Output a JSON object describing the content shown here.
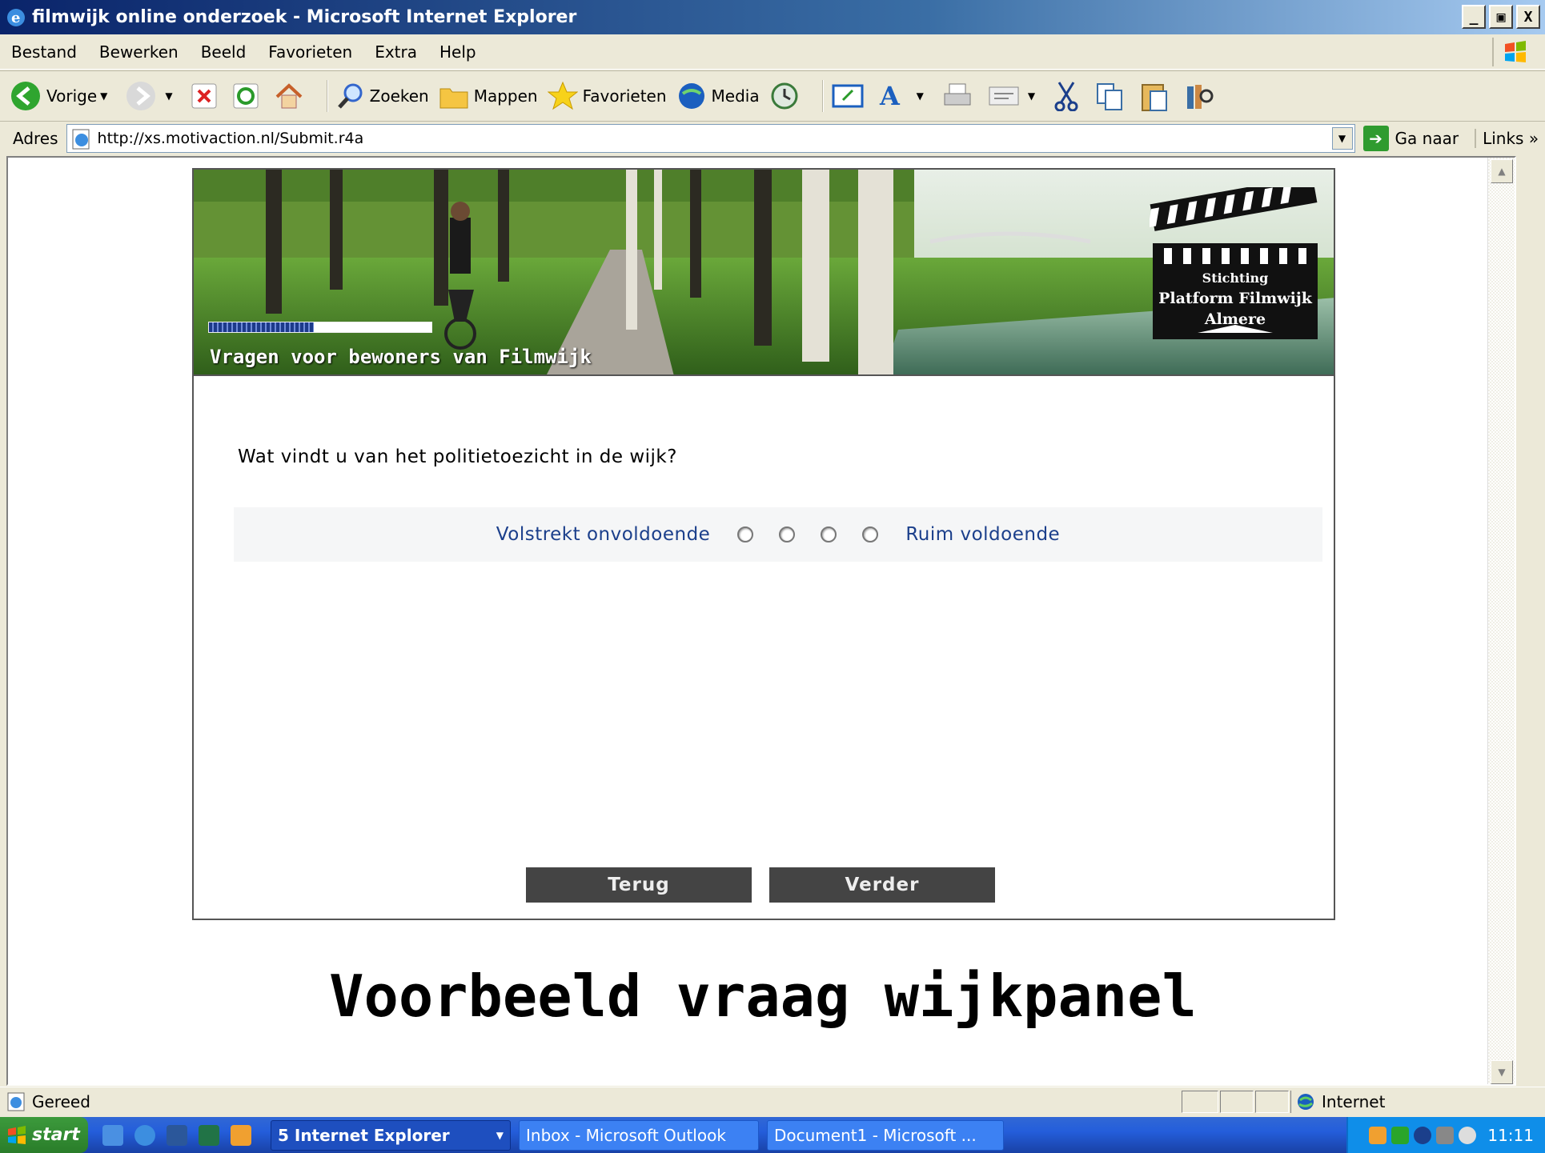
{
  "window": {
    "title": "filmwijk online onderzoek - Microsoft Internet Explorer",
    "minimize": "_",
    "maximize": "̸",
    "close": "X"
  },
  "menu": [
    "Bestand",
    "Bewerken",
    "Beeld",
    "Favorieten",
    "Extra",
    "Help"
  ],
  "toolbar": {
    "back": "Vorige",
    "search": "Zoeken",
    "folders": "Mappen",
    "favorites": "Favorieten",
    "media": "Media"
  },
  "address": {
    "label": "Adres",
    "url": "http://xs.motivaction.nl/Submit.r4a",
    "go": "Ga naar",
    "links": "Links"
  },
  "page": {
    "banner_title": "Vragen voor bewoners van Filmwijk",
    "logo_line1": "Stichting",
    "logo_line2": "Platform Filmwijk",
    "logo_line3": "Almere",
    "progress": 0.47,
    "question": "Wat vindt u van het politietoezicht in de wijk?",
    "scale_low": "Volstrekt onvoldoende",
    "scale_high": "Ruim voldoende",
    "back_button": "Terug",
    "next_button": "Verder"
  },
  "caption": "Voorbeeld vraag wijkpanel",
  "status": {
    "text": "Gereed",
    "zone": "Internet"
  },
  "taskbar": {
    "start": "start",
    "task1": "5 Internet Explorer",
    "task2": "Inbox - Microsoft Outlook",
    "task3": "Document1 - Microsoft ...",
    "clock": "11:11"
  }
}
